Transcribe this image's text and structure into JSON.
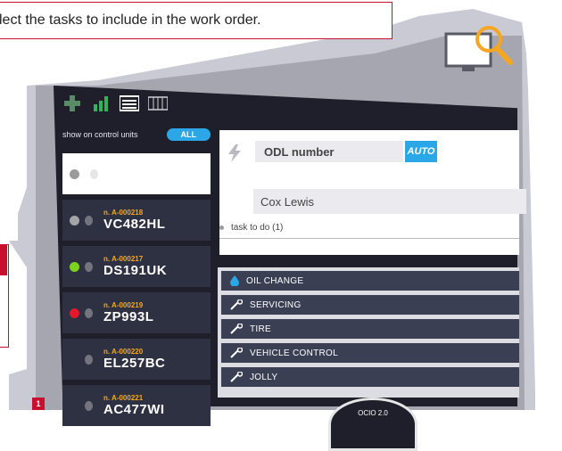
{
  "callout": {
    "text": "lect the tasks to include in the work order."
  },
  "toolbar": {
    "icons": [
      "plus-icon",
      "bar-chart-icon",
      "list-icon",
      "grid-icon"
    ]
  },
  "filter": {
    "label": "show on control units",
    "pill": "ALL"
  },
  "units": [
    {
      "number": "n. A-000218",
      "plate": "VC482HL",
      "status_color": "#a5a5a5"
    },
    {
      "number": "n. A-000217",
      "plate": "DS191UK",
      "status_color": "#7ed321"
    },
    {
      "number": "n. A-000219",
      "plate": "ZP993L",
      "status_color": "#e3192b"
    },
    {
      "number": "n. A-000220",
      "plate": "EL257BC",
      "status_color": ""
    },
    {
      "number": "n. A-000221",
      "plate": "AC477WI",
      "status_color": ""
    }
  ],
  "badge": "1",
  "odl": {
    "placeholder": "ODL number",
    "auto": "AUTO"
  },
  "assignee": "Cox Lewis",
  "task_to_do": "task to do (1)",
  "tasks": [
    {
      "label": "OIL CHANGE",
      "icon": "droplet-icon"
    },
    {
      "label": "SERVICING",
      "icon": "wrench-icon"
    },
    {
      "label": "TIRE",
      "icon": "wrench-icon"
    },
    {
      "label": "VEHICLE CONTROL",
      "icon": "wrench-icon"
    },
    {
      "label": "JOLLY",
      "icon": "wrench-icon"
    }
  ],
  "gauge": "OCIO 2.0",
  "colors": {
    "accent": "#2ba6e7",
    "brand_red": "#c8102e",
    "dark": "#1e1f2a"
  }
}
